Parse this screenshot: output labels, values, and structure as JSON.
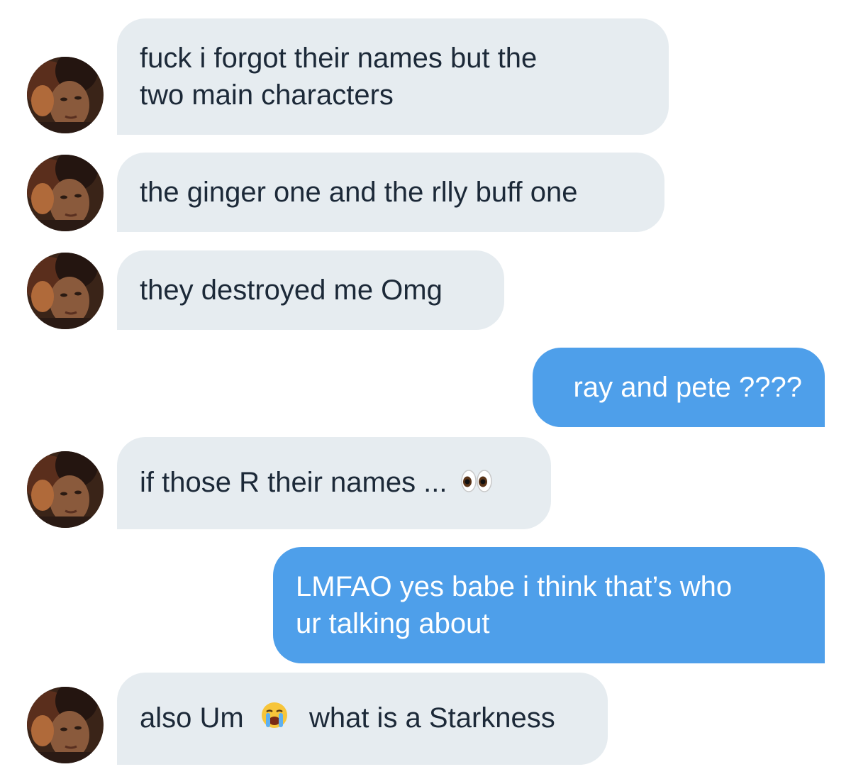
{
  "conversation": {
    "messages": [
      {
        "direction": "received",
        "lines": [
          "fuck i forgot their names but the",
          "two main characters"
        ]
      },
      {
        "direction": "received",
        "text": "the ginger one and the rlly buff one"
      },
      {
        "direction": "received",
        "text": "they destroyed me Omg"
      },
      {
        "direction": "sent",
        "text": "ray and pete ????"
      },
      {
        "direction": "received",
        "text": "if those R their names ...",
        "emoji": "eyes-emoji"
      },
      {
        "direction": "sent",
        "lines": [
          "LMFAO yes babe i think that’s who",
          "ur talking about"
        ]
      },
      {
        "direction": "received",
        "text_before": "also Um",
        "emoji": "loudly-crying-face-emoji",
        "text_after": "what is a Starkness"
      }
    ]
  },
  "colors": {
    "received_bubble": "#e6ecf0",
    "sent_bubble": "#4e9fea",
    "received_text": "#1c2938",
    "sent_text": "#ffffff"
  }
}
